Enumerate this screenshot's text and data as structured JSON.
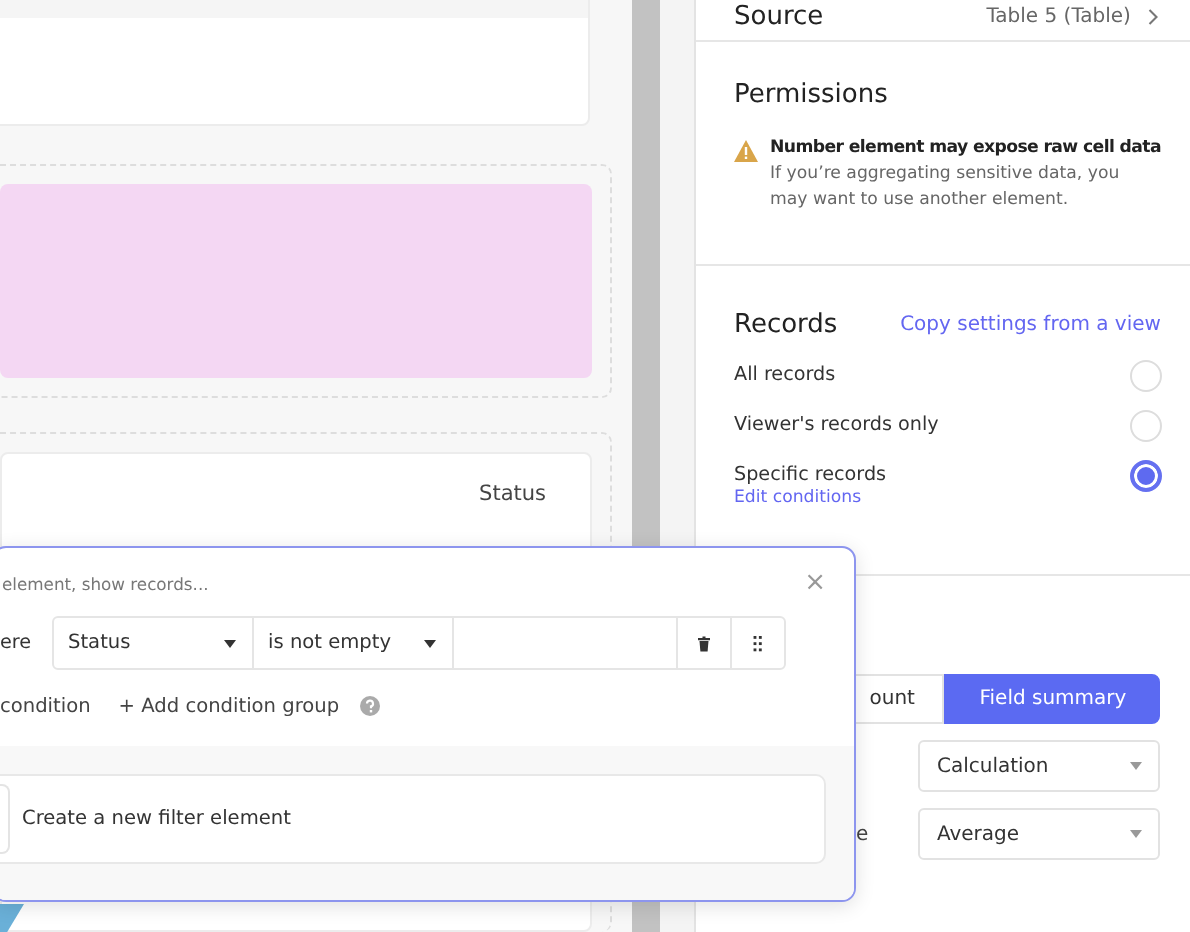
{
  "canvas": {
    "table_card": {
      "column_header": "Status"
    }
  },
  "panel": {
    "source": {
      "label": "Source",
      "value": "Table 5 (Table)"
    },
    "permissions": {
      "title": "Permissions",
      "warning": {
        "title": "Number element may expose raw cell data",
        "body": "If you’re aggregating sensitive data, you may want to use another element."
      }
    },
    "records": {
      "title": "Records",
      "link": "Copy settings from a view",
      "options": [
        {
          "label": "All records",
          "selected": false
        },
        {
          "label": "Viewer's records only",
          "selected": false
        },
        {
          "label": "Specific records",
          "selected": true,
          "link": "Edit conditions"
        }
      ]
    },
    "summary": {
      "tabs": [
        {
          "label": "ount",
          "selected": false
        },
        {
          "label": "Field summary",
          "selected": true
        }
      ],
      "fields": [
        {
          "value": "Calculation"
        },
        {
          "label": "e",
          "value": "Average"
        }
      ]
    }
  },
  "popover": {
    "hint": "element, show records...",
    "close": "×",
    "condition": {
      "prefix": "ere",
      "field": "Status",
      "operator": "is not empty"
    },
    "actions": [
      "condition",
      "+ Add condition group"
    ],
    "footer": "Create a new filter element"
  }
}
